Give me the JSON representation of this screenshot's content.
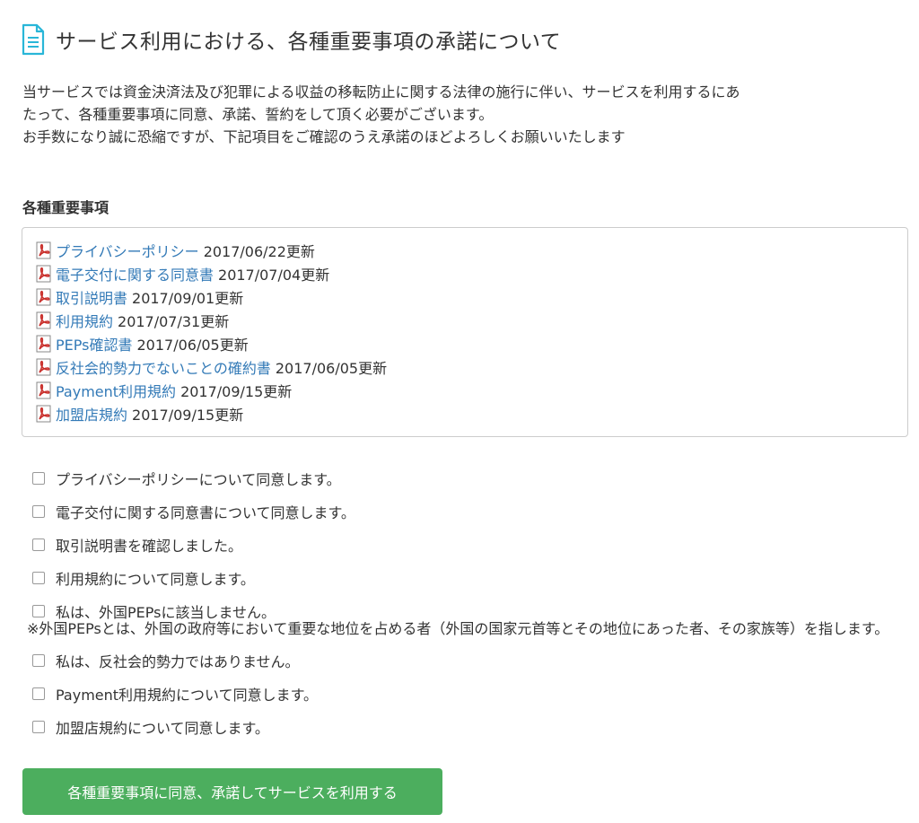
{
  "header": {
    "title": "サービス利用における、各種重要事項の承諾について",
    "icon": "document-icon",
    "icon_color": "#29b6d8"
  },
  "intro": {
    "line1": "当サービスでは資金決済法及び犯罪による収益の移転防止に関する法律の施行に伴い、サービスを利用するにあ",
    "line2": "たって、各種重要事項に同意、承諾、誓約をして頂く必要がございます。",
    "line3": "お手数になり誠に恐縮ですが、下記項目をご確認のうえ承諾のほどよろしくお願いいたします"
  },
  "documents": {
    "heading": "各種重要事項",
    "items": [
      {
        "label": "プライバシーポリシー",
        "date": "2017/06/22更新"
      },
      {
        "label": "電子交付に関する同意書",
        "date": "2017/07/04更新"
      },
      {
        "label": "取引説明書",
        "date": "2017/09/01更新"
      },
      {
        "label": "利用規約",
        "date": "2017/07/31更新"
      },
      {
        "label": "PEPs確認書",
        "date": "2017/06/05更新"
      },
      {
        "label": "反社会的勢力でないことの確約書",
        "date": "2017/06/05更新"
      },
      {
        "label": "Payment利用規約",
        "date": "2017/09/15更新"
      },
      {
        "label": "加盟店規約",
        "date": "2017/09/15更新"
      }
    ],
    "link_color": "#337ab7",
    "pdf_icon": "pdf-icon",
    "pdf_icon_color": "#c9302c"
  },
  "agreements": {
    "items": [
      {
        "label": "プライバシーポリシーについて同意します。",
        "checked": false
      },
      {
        "label": "電子交付に関する同意書について同意します。",
        "checked": false
      },
      {
        "label": "取引説明書を確認しました。",
        "checked": false
      },
      {
        "label": "利用規約について同意します。",
        "checked": false
      },
      {
        "label": "私は、外国PEPsに該当しません。",
        "checked": false
      },
      {
        "label": "私は、反社会的勢力ではありません。",
        "checked": false
      },
      {
        "label": "Payment利用規約について同意します。",
        "checked": false
      },
      {
        "label": "加盟店規約について同意します。",
        "checked": false
      }
    ],
    "peps_note": "※外国PEPsとは、外国の政府等において重要な地位を占める者（外国の国家元首等とその地位にあった者、その家族等）を指します。"
  },
  "submit": {
    "label": "各種重要事項に同意、承諾してサービスを利用する",
    "color": "#4cae5e"
  }
}
